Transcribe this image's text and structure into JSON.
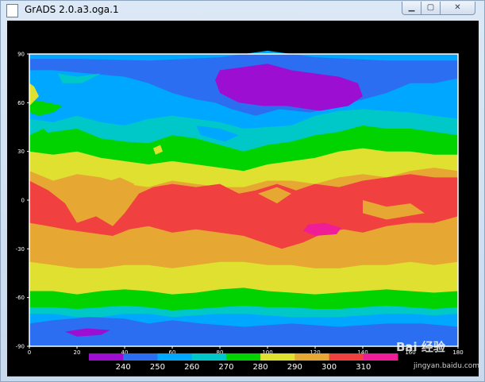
{
  "window": {
    "title": "GrADS 2.0.a3.oga.1",
    "minimize_glyph": "▁",
    "maximize_glyph": "▢",
    "close_glyph": "✕"
  },
  "chart_data": {
    "type": "heatmap",
    "title": "",
    "xlabel": "",
    "ylabel": "",
    "x_ticks": [
      "0",
      "20",
      "40",
      "60",
      "80",
      "100",
      "120",
      "140",
      "160",
      "180"
    ],
    "y_ticks": [
      "90",
      "60",
      "30",
      "0",
      "-30",
      "-60",
      "-90"
    ],
    "xlim": [
      0,
      180
    ],
    "ylim": [
      -90,
      90
    ],
    "colorbar": {
      "labels": [
        "240",
        "250",
        "260",
        "270",
        "280",
        "290",
        "300",
        "310"
      ],
      "colors": [
        "#9c0fd2",
        "#2b6ef2",
        "#00a7ff",
        "#00c8c8",
        "#00d300",
        "#e0e030",
        "#e6a832",
        "#f04040",
        "#f01e96"
      ]
    },
    "colors": {
      "240": "#9c0fd2",
      "250": "#2b6ef2",
      "260": "#00a7ff",
      "270": "#00c8c8",
      "280": "#00d300",
      "290": "#e0e030",
      "300": "#e6a832",
      "310": "#f04040",
      "320": "#f01e96"
    }
  },
  "watermark": {
    "text": "Bai 经验",
    "sub": "jingyan.baidu.com"
  }
}
